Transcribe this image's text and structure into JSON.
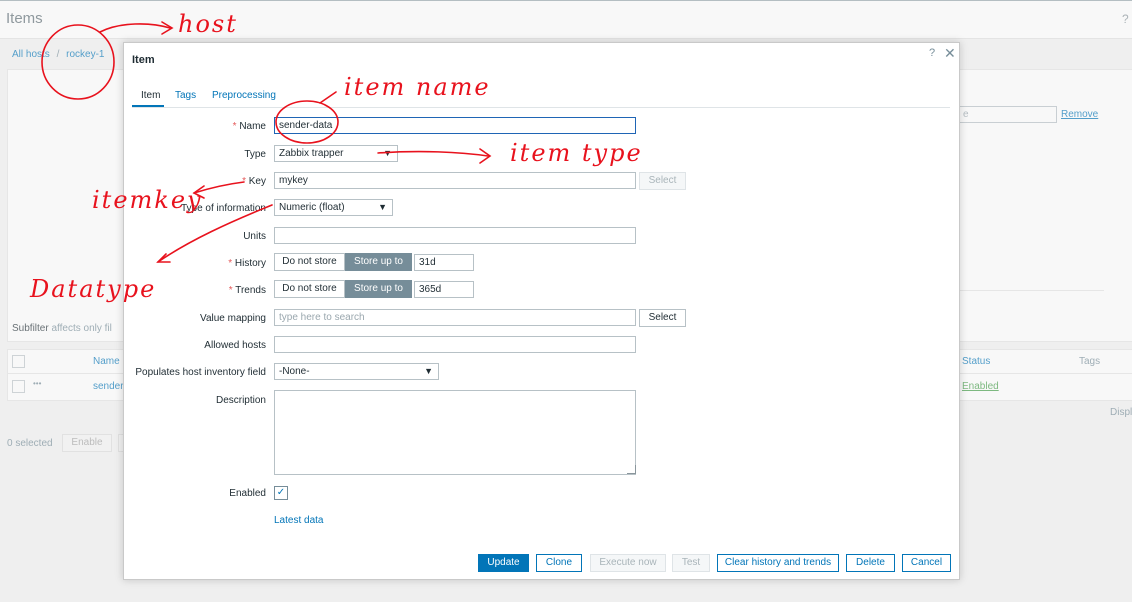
{
  "page": {
    "title": "Items",
    "help_icon": "?",
    "breadcrumb": {
      "all_hosts": "All hosts",
      "separator": "/",
      "host": "rockey-1"
    },
    "subfilter": {
      "label": "Subfilter",
      "note": "affects only fil"
    },
    "remove_link": "Remove",
    "table": {
      "name_header": "Name ▲",
      "status_header": "Status",
      "tags_header": "Tags",
      "row_name": "sender",
      "row_status": "Enabled",
      "row_more": "•••"
    },
    "displaying": "Displ",
    "selected_count": "0 selected",
    "enable_button": "Enable"
  },
  "dialog": {
    "title": "Item",
    "help_icon": "?",
    "close_icon": "✕",
    "tabs": [
      {
        "label": "Item"
      },
      {
        "label": "Tags"
      },
      {
        "label": "Preprocessing"
      }
    ],
    "form": {
      "name": {
        "label": "Name",
        "required": "*",
        "value": "sender-data"
      },
      "type": {
        "label": "Type",
        "value": "Zabbix trapper"
      },
      "key": {
        "label": "Key",
        "required": "*",
        "value": "mykey",
        "select_label": "Select"
      },
      "type_of_information": {
        "label": "Type of information",
        "value": "Numeric (float)"
      },
      "units": {
        "label": "Units",
        "value": ""
      },
      "history": {
        "label": "History",
        "required": "*",
        "do_not_store": "Do not store",
        "store_up_to": "Store up to",
        "value": "31d"
      },
      "trends": {
        "label": "Trends",
        "required": "*",
        "do_not_store": "Do not store",
        "store_up_to": "Store up to",
        "value": "365d"
      },
      "value_mapping": {
        "label": "Value mapping",
        "placeholder": "type here to search",
        "select_label": "Select"
      },
      "allowed_hosts": {
        "label": "Allowed hosts",
        "value": ""
      },
      "inventory": {
        "label": "Populates host inventory field",
        "value": "-None-"
      },
      "description": {
        "label": "Description",
        "value": ""
      },
      "enabled": {
        "label": "Enabled",
        "checked": true,
        "check_glyph": "✓"
      },
      "latest_data_link": "Latest data"
    },
    "footer": {
      "update": "Update",
      "clone": "Clone",
      "execute_now": "Execute now",
      "test": "Test",
      "clear_history": "Clear history and trends",
      "delete": "Delete",
      "cancel": "Cancel"
    }
  },
  "annotations": {
    "host": "host",
    "item_name": "item name",
    "item_type": "item type",
    "item_key": "itemkey",
    "data_type": "Datatype"
  },
  "colors": {
    "accent": "#0275b8",
    "annotation": "#e8121d",
    "required": "#e45959",
    "enabled_status": "#429e47"
  }
}
